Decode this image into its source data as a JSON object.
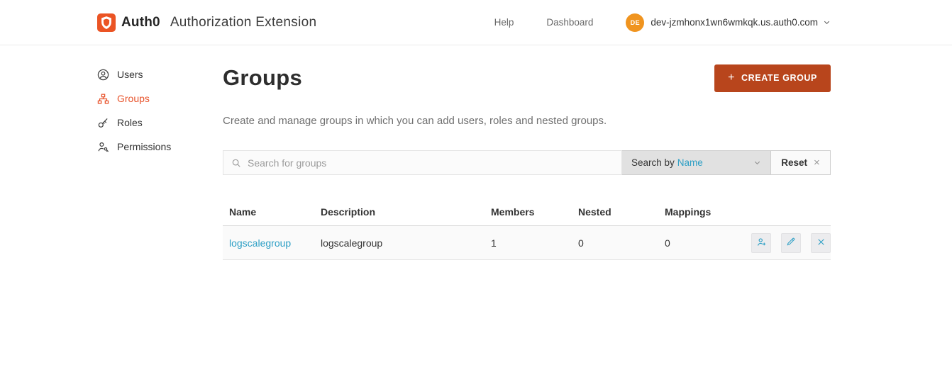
{
  "header": {
    "brand": "Auth0",
    "app_title": "Authorization Extension",
    "nav": {
      "help": "Help",
      "dashboard": "Dashboard"
    },
    "user": {
      "initials": "DE",
      "domain": "dev-jzmhonx1wn6wmkqk.us.auth0.com"
    }
  },
  "sidebar": {
    "items": [
      {
        "label": "Users",
        "icon": "user-circle-icon"
      },
      {
        "label": "Groups",
        "icon": "sitemap-icon"
      },
      {
        "label": "Roles",
        "icon": "key-icon"
      },
      {
        "label": "Permissions",
        "icon": "user-key-icon"
      }
    ]
  },
  "main": {
    "title": "Groups",
    "create_button_label": "CREATE GROUP",
    "subtitle": "Create and manage groups in which you can add users, roles and nested groups.",
    "search": {
      "placeholder": "Search for groups",
      "search_by_label": "Search by",
      "search_by_value": "Name",
      "reset_label": "Reset"
    },
    "table": {
      "columns": [
        "Name",
        "Description",
        "Members",
        "Nested",
        "Mappings"
      ],
      "rows": [
        {
          "name": "logscalegroup",
          "description": "logscalegroup",
          "members": "1",
          "nested": "0",
          "mappings": "0"
        }
      ]
    }
  },
  "icons": {
    "plus": "+",
    "close": "×"
  },
  "colors": {
    "brand_orange": "#eb5424",
    "active_orange": "#e8542c",
    "button_orange": "#b8451c",
    "link_blue": "#2d9fc5",
    "avatar_orange": "#f0941f"
  }
}
